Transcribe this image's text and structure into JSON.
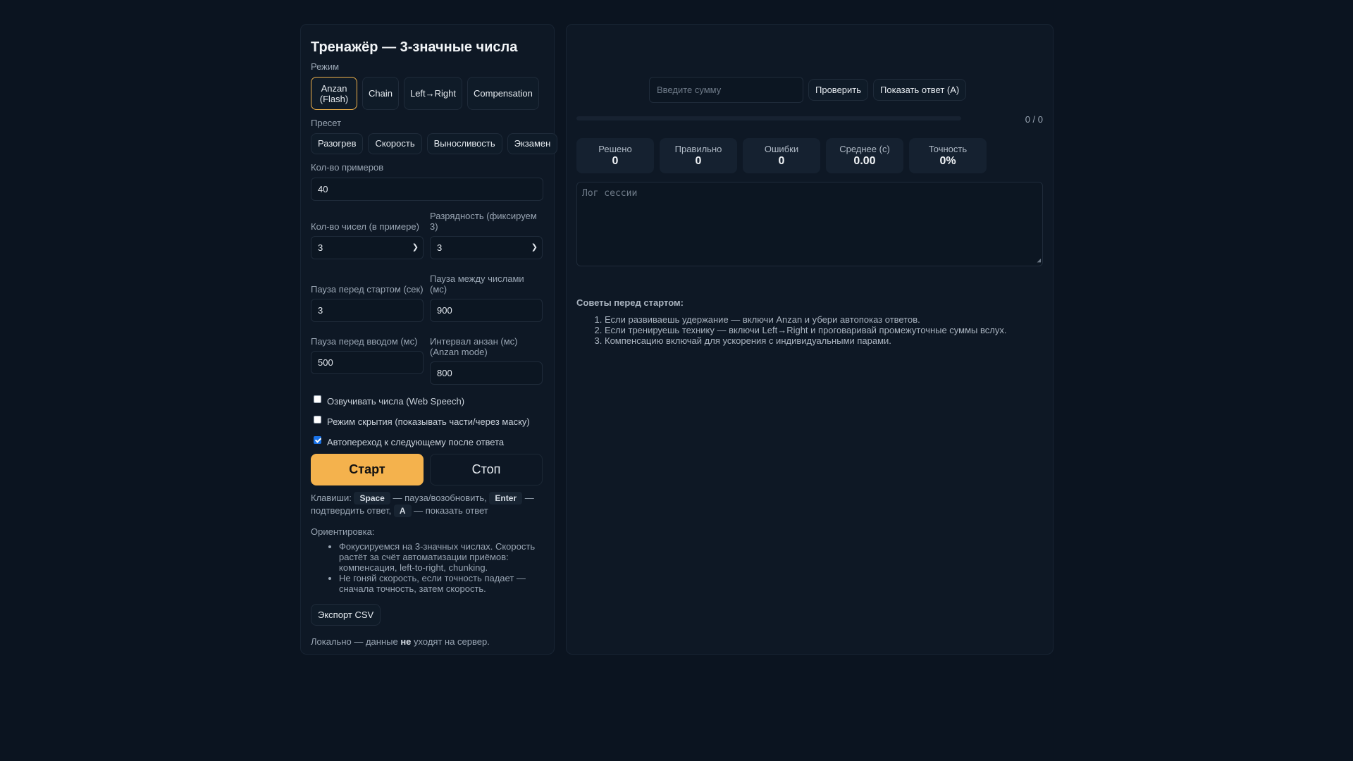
{
  "title": "Тренажёр — 3-значные числа",
  "mode": {
    "label": "Режим",
    "options": [
      "Anzan (Flash)",
      "Chain",
      "Left→Right",
      "Compensation"
    ],
    "active": "Anzan (Flash)"
  },
  "preset": {
    "label": "Пресет",
    "options": [
      "Разогрев",
      "Скорость",
      "Выносливость",
      "Экзамен"
    ]
  },
  "count": {
    "label": "Кол-во примеров",
    "value": "40"
  },
  "numbers_per_example": {
    "label": "Кол-во чисел (в примере)",
    "value": "3"
  },
  "digits": {
    "label": "Разрядность (фиксируем 3)",
    "value": "3"
  },
  "pause_before_start": {
    "label": "Пауза перед стартом (сек)",
    "value": "3"
  },
  "pause_between": {
    "label": "Пауза между числами (мс)",
    "value": "900"
  },
  "pause_before_input": {
    "label": "Пауза перед вводом (мс)",
    "value": "500"
  },
  "anzan_interval": {
    "label": "Интервал анзан (мс) (Anzan mode)",
    "value": "800"
  },
  "checkboxes": [
    {
      "label": "Озвучивать числа (Web Speech)",
      "checked": false
    },
    {
      "label": "Режим скрытия (показывать части/через маску)",
      "checked": false
    },
    {
      "label": "Автопереход к следующему после ответа",
      "checked": true
    }
  ],
  "start_label": "Старт",
  "stop_label": "Стоп",
  "keys": {
    "prefix": "Клавиши:",
    "space": "Space",
    "space_desc": "— пауза/возобновить,",
    "enter": "Enter",
    "enter_desc": "— подтвердить ответ,",
    "a": "A",
    "a_desc": "— показать ответ"
  },
  "orientation": {
    "label": "Ориентировка:",
    "items": [
      "Фокусируемся на 3-значных числах. Скорость растёт за счёт автоматизации приёмов: компенсация, left-to-right, chunking.",
      "Не гоняй скорость, если точность падает — сначала точность, затем скорость."
    ]
  },
  "export_label": "Экспорт CSV",
  "footer": {
    "before": "Локально — данные ",
    "bold": "не",
    "after": " уходят на сервер."
  },
  "answer": {
    "placeholder": "Введите сумму",
    "check_label": "Проверить",
    "show_label": "Показать ответ (A)"
  },
  "progress": {
    "text": "0 / 0",
    "fraction": 0
  },
  "stats": [
    {
      "label": "Решено",
      "value": "0"
    },
    {
      "label": "Правильно",
      "value": "0"
    },
    {
      "label": "Ошибки",
      "value": "0"
    },
    {
      "label": "Среднее (с)",
      "value": "0.00"
    },
    {
      "label": "Точность",
      "value": "0%"
    }
  ],
  "log_placeholder": "Лог сессии",
  "tips": {
    "title": "Советы перед стартом:",
    "items": [
      "Если развиваешь удержание — включи Anzan и убери автопоказ ответов.",
      "Если тренируешь технику — включи Left→Right и проговаривай промежуточные суммы вслух.",
      "Компенсацию включай для ускорения с индивидуальными парами."
    ]
  }
}
